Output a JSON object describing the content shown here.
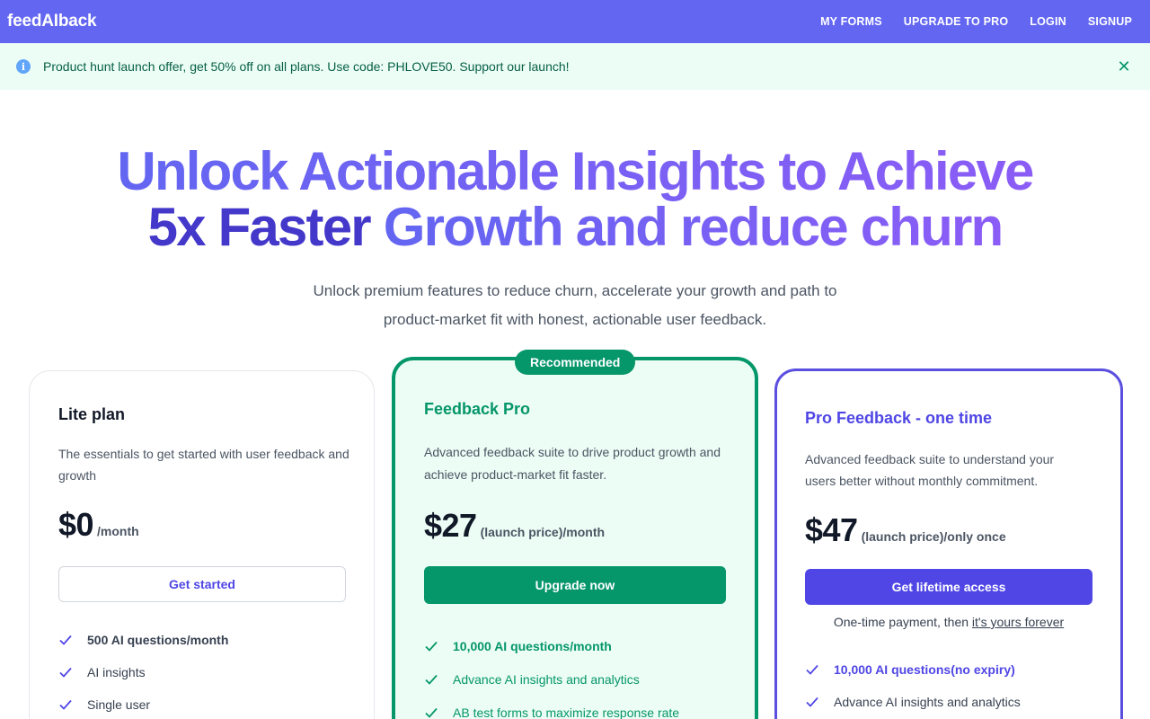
{
  "nav": {
    "brand": "feedAIback",
    "links": [
      "MY FORMS",
      "UPGRADE TO PRO",
      "LOGIN",
      "SIGNUP"
    ]
  },
  "alert": {
    "icon": "info-icon",
    "text": "Product hunt launch offer, get 50% off on all plans. Use code: PHLOVE50. Support our launch!",
    "close_icon": "close-icon"
  },
  "hero": {
    "line1": "Unlock Actionable Insights to Achieve",
    "line2_strong": "5x Faster",
    "line2_rest": "Growth and reduce churn",
    "sub1": "Unlock premium features to reduce churn, accelerate your growth and path to",
    "sub2": "product-market fit with honest, actionable user feedback."
  },
  "plans": [
    {
      "title": "Lite plan",
      "desc": "The essentials to get started with user feedback and growth",
      "price": "$0",
      "unit": "/month",
      "button": "Get started",
      "features": [
        "500 AI questions/month",
        "AI insights",
        "Single user"
      ]
    },
    {
      "badge": "Recommended",
      "title": "Feedback Pro",
      "desc": "Advanced feedback suite to drive product growth and achieve product-market fit faster.",
      "price": "$27",
      "unit": "(launch price)/month",
      "button": "Upgrade now",
      "features": [
        "10,000 AI questions/month",
        "Advance AI insights and analytics",
        "AB test forms to maximize response rate"
      ]
    },
    {
      "title": "Pro Feedback - one time",
      "desc": "Advanced feedback suite to understand your users better without monthly commitment.",
      "price": "$47",
      "unit": "(launch price)/only once",
      "button": "Get lifetime access",
      "note_pre": "One-time payment, then",
      "note_link": "it's yours forever",
      "features": [
        "10,000 AI questions(no expiry)",
        "Advance AI insights and analytics"
      ]
    }
  ],
  "colors": {
    "brand": "#6366f1",
    "green": "#059669",
    "indigo": "#4f46e5"
  }
}
